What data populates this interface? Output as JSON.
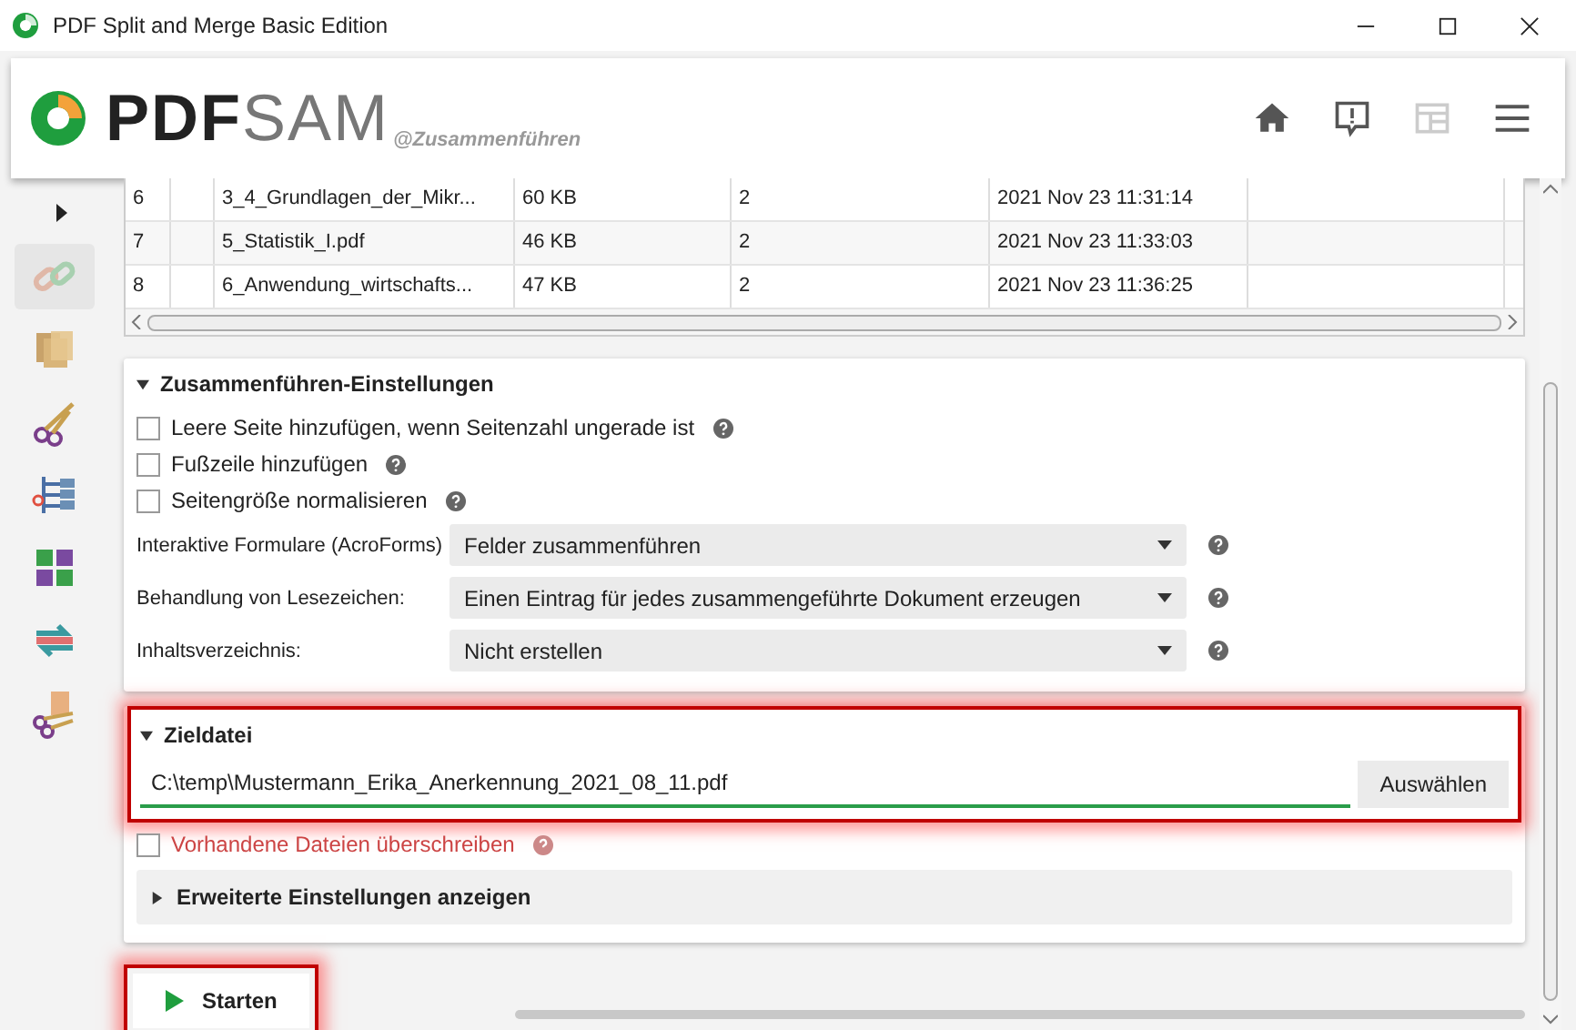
{
  "window": {
    "title": "PDF Split and Merge Basic Edition"
  },
  "header": {
    "logo_dark": "PDF",
    "logo_light": "SAM",
    "module": "@Zusammenführen"
  },
  "table": {
    "rows": [
      {
        "cells": [
          "6",
          "",
          "3_4_Grundlagen_der_Mikr...",
          "60 KB",
          "2",
          "2021 Nov 23 11:31:14",
          ""
        ]
      },
      {
        "cells": [
          "7",
          "",
          "5_Statistik_I.pdf",
          "46 KB",
          "2",
          "2021 Nov 23 11:33:03",
          ""
        ]
      },
      {
        "cells": [
          "8",
          "",
          "6_Anwendung_wirtschafts...",
          "47 KB",
          "2",
          "2021 Nov 23 11:36:25",
          ""
        ]
      }
    ]
  },
  "sidebar": {
    "items": [
      {
        "kind": "chain",
        "selected": true
      },
      {
        "kind": "pages",
        "selected": false
      },
      {
        "kind": "scissors",
        "selected": false
      },
      {
        "kind": "tree",
        "selected": false
      },
      {
        "kind": "grid",
        "selected": false
      },
      {
        "kind": "rotate",
        "selected": false
      },
      {
        "kind": "cutpages",
        "selected": false
      }
    ]
  },
  "settings": {
    "title": "Zusammenführen-Einstellungen",
    "expanded": true,
    "options": [
      {
        "label": "Leere Seite hinzufügen, wenn Seitenzahl ungerade ist",
        "checked": false
      },
      {
        "label": "Fußzeile hinzufügen",
        "checked": false
      },
      {
        "label": "Seitengröße normalisieren",
        "checked": false
      }
    ],
    "selects": [
      {
        "label": "Interaktive Formulare (AcroForms)",
        "value": "Felder zusammenführen"
      },
      {
        "label": "Behandlung von Lesezeichen:",
        "value": "Einen Eintrag für jedes zusammengeführte Dokument erzeugen"
      },
      {
        "label": "Inhaltsverzeichnis:",
        "value": "Nicht erstellen"
      }
    ]
  },
  "destination": {
    "title": "Zieldatei",
    "expanded": true,
    "highlighted": true,
    "value": "C:\\temp\\Mustermann_Erika_Anerkennung_2021_08_11.pdf",
    "browse": "Auswählen",
    "overwrite": {
      "label": "Vorhandene Dateien überschreiben",
      "checked": false
    },
    "advanced": {
      "label": "Erweiterte Einstellungen anzeigen",
      "expanded": false
    }
  },
  "run": {
    "label": "Starten",
    "highlighted": true
  }
}
